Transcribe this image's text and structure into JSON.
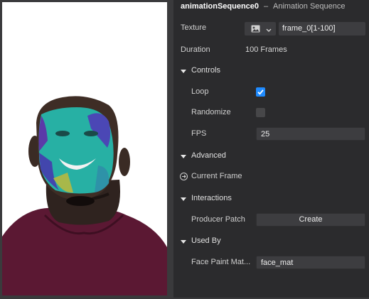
{
  "inspector": {
    "object_name": "animationSequence0",
    "separator": "–",
    "object_type": "Animation Sequence"
  },
  "properties": {
    "texture_label": "Texture",
    "texture_icon": "image-icon",
    "texture_value": "frame_0[1-100]",
    "duration_label": "Duration",
    "duration_value": "100 Frames"
  },
  "controls": {
    "title": "Controls",
    "loop_label": "Loop",
    "loop_checked": true,
    "randomize_label": "Randomize",
    "randomize_checked": false,
    "fps_label": "FPS",
    "fps_value": "25"
  },
  "advanced": {
    "title": "Advanced",
    "current_frame_label": "Current Frame"
  },
  "interactions": {
    "title": "Interactions",
    "producer_patch_label": "Producer Patch",
    "create_button": "Create"
  },
  "used_by": {
    "title": "Used By",
    "face_paint_label": "Face Paint Mat...",
    "face_paint_value": "face_mat"
  },
  "colors": {
    "accent": "#1f8bff",
    "panel_bg": "#2b2b2d",
    "field_bg": "#3d3d40"
  }
}
